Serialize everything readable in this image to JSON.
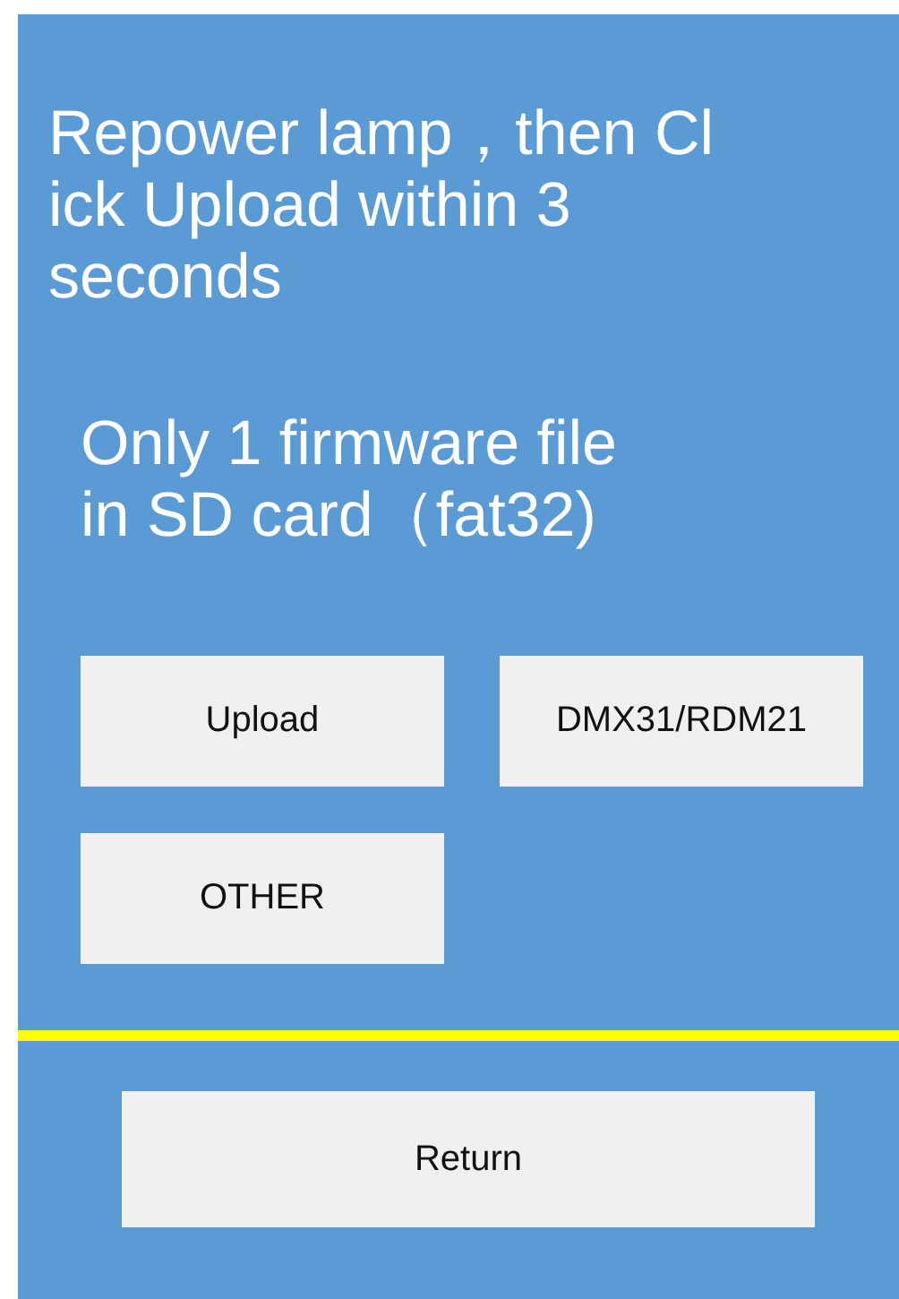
{
  "instruction_lines": [
    "Repower lamp，then Cl",
    "ick Upload within 3",
    "seconds"
  ],
  "note_lines": [
    "Only 1 firmware file",
    "in SD card（fat32)"
  ],
  "buttons": [
    {
      "label": "Upload"
    },
    {
      "label": "DMX31/RDM21"
    },
    {
      "label": "OTHER"
    }
  ],
  "return_button": {
    "label": "Return"
  }
}
